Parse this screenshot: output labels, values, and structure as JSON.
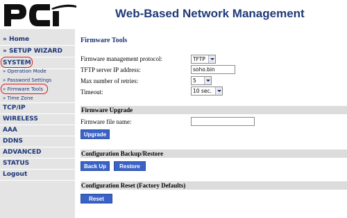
{
  "header": {
    "logo_text": "PCi",
    "title": "Web-Based Network Management",
    "title_color": "#1f3a78"
  },
  "sidebar": {
    "items": [
      {
        "label": "» Home"
      },
      {
        "label": "» SETUP WIZARD"
      },
      {
        "label": "SYSTEM",
        "highlighted": true
      },
      {
        "label": "» Operation Mode",
        "sub": true
      },
      {
        "label": "» Password Settings",
        "sub": true
      },
      {
        "label": "» Firmware Tools",
        "sub": true,
        "highlighted": true
      },
      {
        "label": "» Time Zone",
        "sub": true
      },
      {
        "label": "TCP/IP"
      },
      {
        "label": "WIRELESS"
      },
      {
        "label": "AAA"
      },
      {
        "label": "DDNS"
      },
      {
        "label": "ADVANCED"
      },
      {
        "label": "STATUS"
      },
      {
        "label": "Logout"
      }
    ],
    "highlight_color": "#e01818"
  },
  "main": {
    "title": "Firmware Tools",
    "fields": {
      "protocol": {
        "label": "Firmware management protocol:",
        "value": "TFTP"
      },
      "server_ip": {
        "label": "TFTP server IP address:",
        "value": "soho.bin"
      },
      "retries": {
        "label": "Max number of retries:",
        "value": "5"
      },
      "timeout": {
        "label": "Timeout:",
        "value": "10 sec."
      }
    },
    "upgrade": {
      "heading": "Firmware Upgrade",
      "file_label": "Firmware file name:",
      "file_value": "",
      "button": "Upgrade"
    },
    "backup": {
      "heading": "Configuration Backup/Restore",
      "backup_button": "Back Up",
      "restore_button": "Restore"
    },
    "reset": {
      "heading": "Configuration Reset (Factory Defaults)",
      "button": "Reset"
    },
    "button_color": "#3a63c8"
  }
}
